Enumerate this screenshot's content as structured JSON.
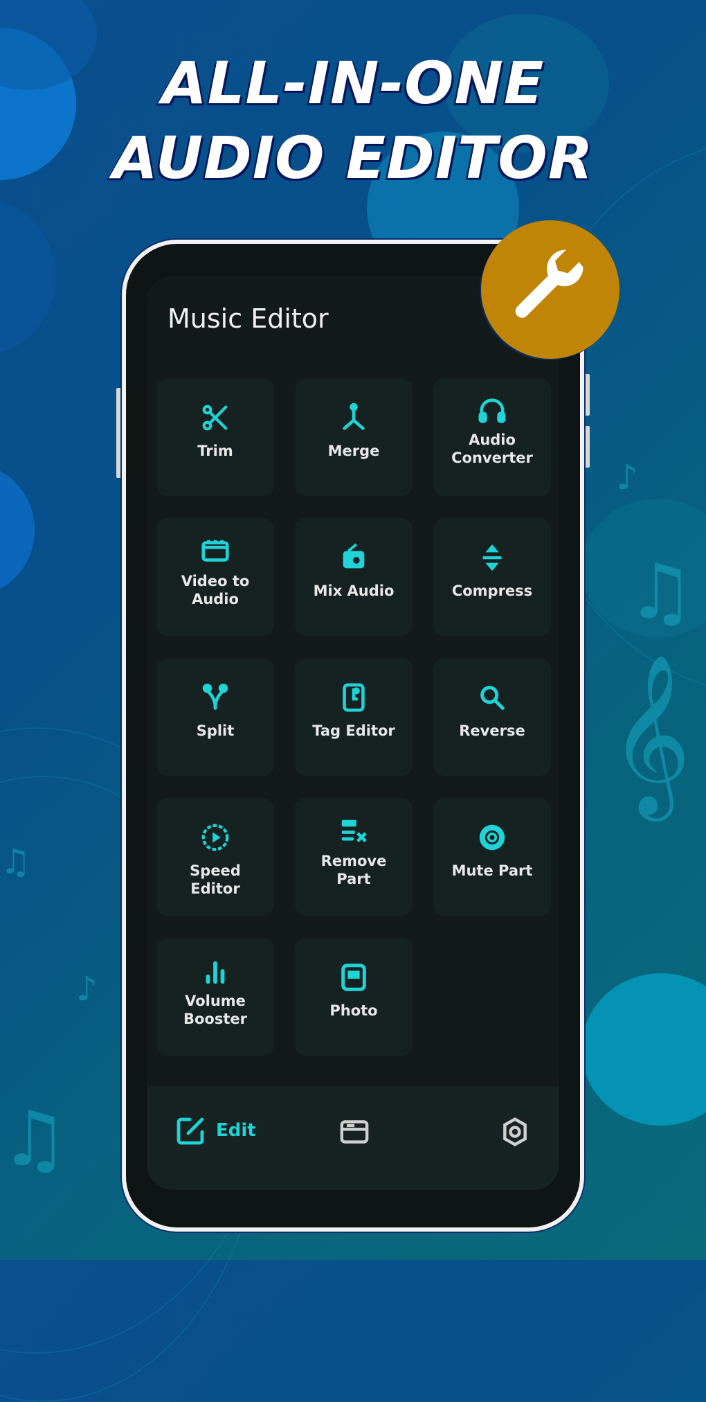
{
  "headline": {
    "line1": "ALL-IN-ONE",
    "line2": "AUDIO EDITOR"
  },
  "colors": {
    "accent": "#1fd3d6",
    "badge": "#c08506",
    "screen_bg": "#131a1a",
    "tile_bg": "#162222"
  },
  "badge": {
    "icon": "wrench-icon"
  },
  "app": {
    "title": "Music Editor",
    "tools": [
      {
        "label": "Trim",
        "icon": "scissors-icon"
      },
      {
        "label": "Merge",
        "icon": "merge-icon"
      },
      {
        "label": "Audio Converter",
        "icon": "headphones-icon"
      },
      {
        "label": "Video to Audio",
        "icon": "video-icon"
      },
      {
        "label": "Mix Audio",
        "icon": "mix-icon"
      },
      {
        "label": "Compress",
        "icon": "compress-icon"
      },
      {
        "label": "Split",
        "icon": "split-icon"
      },
      {
        "label": "Tag Editor",
        "icon": "tag-file-icon"
      },
      {
        "label": "Reverse",
        "icon": "reverse-search-icon"
      },
      {
        "label": "Speed Editor",
        "icon": "speed-icon"
      },
      {
        "label": "Remove Part",
        "icon": "remove-part-icon"
      },
      {
        "label": "Mute Part",
        "icon": "mute-icon"
      },
      {
        "label": "Volume Booster",
        "icon": "volume-bars-icon"
      },
      {
        "label": "Photo",
        "icon": "photo-icon"
      }
    ],
    "nav": [
      {
        "label": "Edit",
        "icon": "edit-icon",
        "active": true
      },
      {
        "label": "",
        "icon": "folder-icon",
        "active": false
      },
      {
        "label": "",
        "icon": "settings-icon",
        "active": false
      }
    ]
  }
}
